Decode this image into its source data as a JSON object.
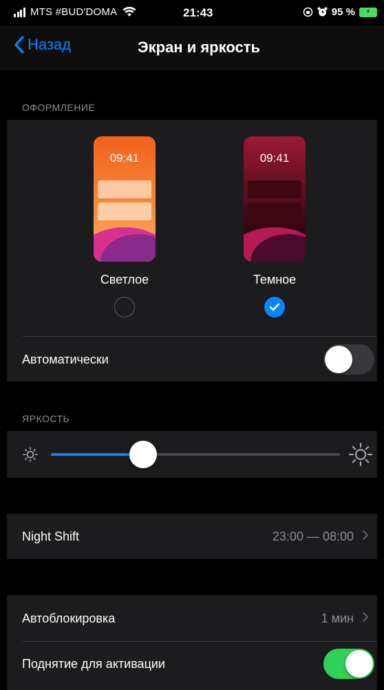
{
  "status_bar": {
    "carrier": "MTS #BUD'DOMA",
    "time": "21:43",
    "battery_percent": "95 %"
  },
  "nav": {
    "back_label": "Назад",
    "title": "Экран и яркость"
  },
  "appearance": {
    "header": "ОФОРМЛЕНИЕ",
    "light": {
      "preview_time": "09:41",
      "label": "Светлое",
      "selected": false
    },
    "dark": {
      "preview_time": "09:41",
      "label": "Темное",
      "selected": true
    },
    "automatic_label": "Автоматически",
    "automatic_on": false
  },
  "brightness": {
    "header": "ЯРКОСТЬ",
    "level": 0.32
  },
  "night_shift": {
    "label": "Night Shift",
    "value": "23:00 — 08:00"
  },
  "auto_lock": {
    "label": "Автоблокировка",
    "value": "1 мин"
  },
  "raise_to_wake": {
    "label": "Поднятие для активации",
    "on": true
  },
  "colors": {
    "accent": "#0a84ff",
    "toggle_on": "#30d158",
    "group_bg": "#1c1c1e"
  }
}
